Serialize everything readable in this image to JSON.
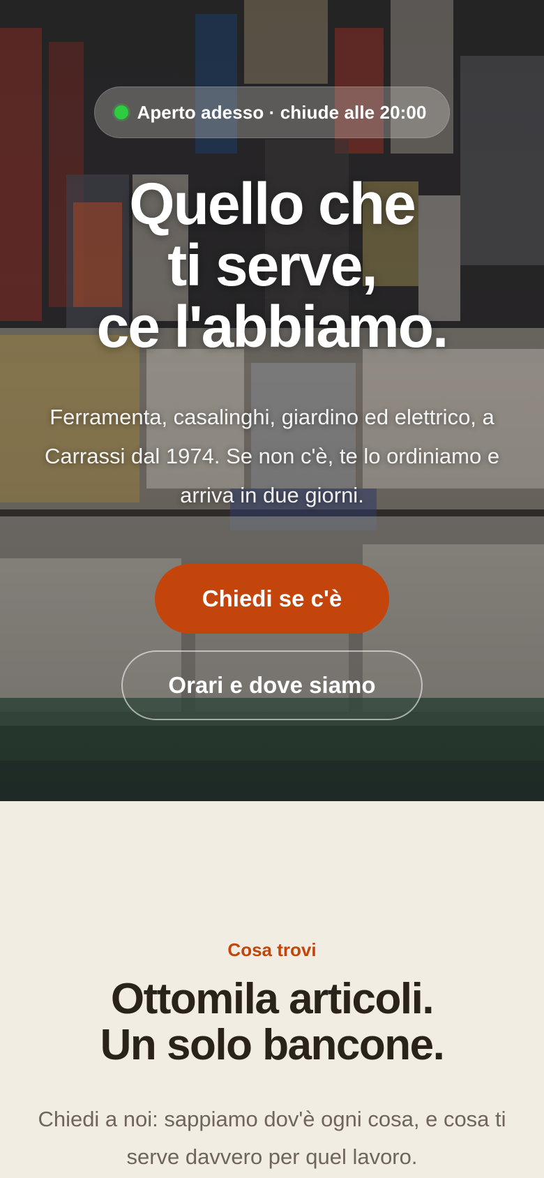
{
  "hero": {
    "status": "Aperto adesso · chiude alle 20:00",
    "title_lines": [
      "Quello che",
      "ti serve,",
      "ce l'abbiamo."
    ],
    "subtitle": "Ferramenta, casalinghi, giardino ed elettrico, a Carrassi dal 1974. Se non c'è, te lo ordiniamo e arriva in due giorni.",
    "primary_button": "Chiedi se c'è",
    "secondary_button": "Orari e dove siamo"
  },
  "section": {
    "eyebrow": "Cosa trovi",
    "title_lines": [
      "Ottomila articoli.",
      "Un solo bancone."
    ],
    "text": "Chiedi a noi: sappiamo dov'è ogni cosa, e cosa ti serve davvero per quel lavoro."
  },
  "colors": {
    "accent": "#C4450C",
    "open_status": "#2ECC40",
    "page_background": "#F2EDE3",
    "heading": "#2A231C",
    "body_text": "#6E655C"
  },
  "icons": {
    "status": "status-dot-icon"
  }
}
